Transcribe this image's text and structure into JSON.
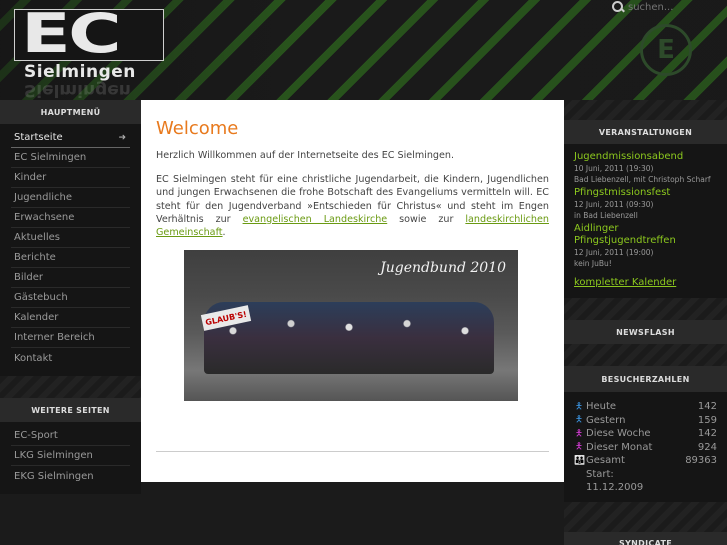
{
  "header": {
    "logo_text": "EC",
    "logo_sub": "Sielmingen",
    "search_placeholder": "suchen..."
  },
  "left_menu": {
    "title": "HAUPTMENÜ",
    "items": [
      {
        "label": "Startseite",
        "active": true
      },
      {
        "label": "EC Sielmingen"
      },
      {
        "label": "Kinder"
      },
      {
        "label": "Jugendliche"
      },
      {
        "label": "Erwachsene"
      },
      {
        "label": "Aktuelles"
      },
      {
        "label": "Berichte"
      },
      {
        "label": "Bilder"
      },
      {
        "label": "Gästebuch"
      },
      {
        "label": "Kalender"
      },
      {
        "label": "Interner Bereich"
      },
      {
        "label": "Kontakt"
      }
    ]
  },
  "more_pages": {
    "title": "WEITERE SEITEN",
    "items": [
      {
        "label": "EC-Sport"
      },
      {
        "label": "LKG Sielmingen"
      },
      {
        "label": "EKG Sielmingen"
      }
    ]
  },
  "main": {
    "title": "Welcome",
    "intro": "Herzlich Willkommen auf der Internetseite des EC Sielmingen.",
    "body_before": "EC Sielmingen steht für eine christliche Jugendarbeit, die Kindern, Jugendlichen und jungen Erwachsenen die frohe Botschaft des Evangeliums vermitteln will. EC steht für den Jugendverband »Entschieden für Christus« und steht im Engen Verhältnis zur ",
    "link1": "evangelischen Landeskirche",
    "body_mid": " sowie zur ",
    "link2": "landeskirchlichen Gemeinschaft",
    "body_end": ".",
    "photo_caption": "Jugendbund 2010",
    "photo_banner": "GLAUB'S!"
  },
  "events": {
    "title": "VERANSTALTUNGEN",
    "items": [
      {
        "name": "Jugendmissionsabend",
        "date": "10 Juni, 2011 (19:30)",
        "place": "Bad Liebenzell, mit Christoph Scharf"
      },
      {
        "name": "Pfingstmissionsfest",
        "date": "12 Juni, 2011 (09:30)",
        "place": "in Bad Liebenzell"
      },
      {
        "name": "Aidlinger Pfingstjugendtreffen",
        "date": "12 Juni, 2011 (19:00)",
        "place": "kein JuBu!"
      }
    ],
    "calendar_link": "kompletter Kalender"
  },
  "newsflash": {
    "title": "NEWSFLASH"
  },
  "visitors": {
    "title": "BESUCHERZAHLEN",
    "rows": [
      {
        "label": "Heute",
        "value": "142",
        "color": "#3a8fd8"
      },
      {
        "label": "Gestern",
        "value": "159",
        "color": "#3a8fd8"
      },
      {
        "label": "Diese Woche",
        "value": "142",
        "color": "#d03ad0"
      },
      {
        "label": "Dieser Monat",
        "value": "924",
        "color": "#d03ad0"
      },
      {
        "label": "Gesamt",
        "value": "89363",
        "color": "#3a8fd8"
      }
    ],
    "start_label": "Start:",
    "start_date": "11.12.2009"
  },
  "syndicate": {
    "title": "SYNDICATE"
  }
}
